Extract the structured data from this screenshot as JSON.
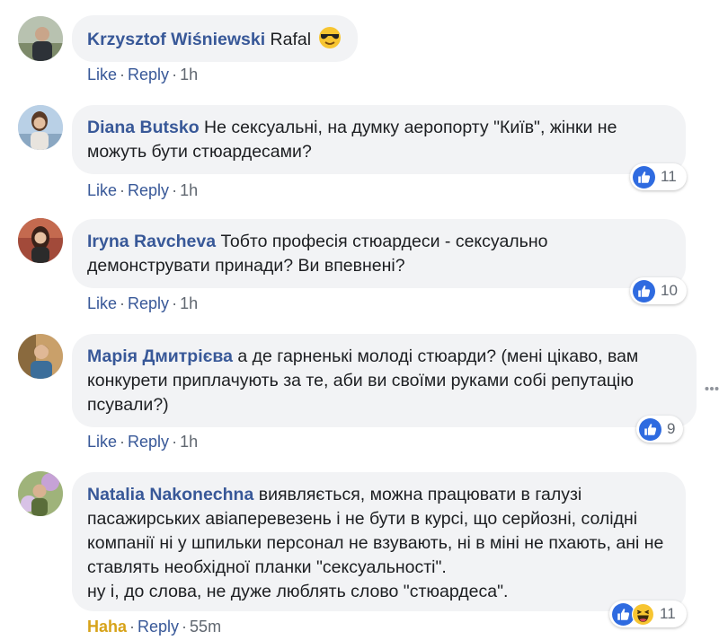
{
  "colors": {
    "author": "#385898",
    "bubble": "#f2f3f5",
    "meta": "#606770",
    "like_blue": "#2f6be0",
    "haha_yellow": "#d7a31a"
  },
  "comments": [
    {
      "author": "Krzysztof Wiśniewski",
      "text": "Rafal",
      "emoji": "sunglasses-emoji",
      "actions": {
        "like": "Like",
        "reply": "Reply",
        "time": "1h"
      },
      "reactions": null
    },
    {
      "author": "Diana Butsko",
      "text": "Не сексуальні, на думку аеропорту \"Київ\", жінки не можуть бути стюардесами?",
      "actions": {
        "like": "Like",
        "reply": "Reply",
        "time": "1h"
      },
      "reactions": {
        "icons": [
          "like-icon"
        ],
        "count": "11"
      }
    },
    {
      "author": "Iryna Ravcheva",
      "text": "Тобто професія стюардеси - сексуально демонструвати принади? Ви впевнені?",
      "actions": {
        "like": "Like",
        "reply": "Reply",
        "time": "1h"
      },
      "reactions": {
        "icons": [
          "like-icon"
        ],
        "count": "10"
      }
    },
    {
      "author": "Марія Дмитрієва",
      "text": "а де гарненькі молоді стюарди? (мені цікаво, вам конкурети приплачують за те, аби ви своїми руками собі репутацію псували?)",
      "actions": {
        "like": "Like",
        "reply": "Reply",
        "time": "1h"
      },
      "reactions": {
        "icons": [
          "like-icon"
        ],
        "count": "9"
      }
    },
    {
      "author": "Natalia Nakonechna",
      "text": "виявляється, можна працювати в галузі пасажирських авіаперевезень і не бути в курсі, що серйозні, солідні компанії ні у шпильки персонал не взувають, ні в міні не пхають, ані не ставлять необхідної планки \"сексуальності\".",
      "text2": "ну і, до слова, не дуже люблять слово \"стюардеса\".",
      "actions": {
        "like": "Haha",
        "reply": "Reply",
        "time": "55m"
      },
      "reactions": {
        "icons": [
          "like-icon",
          "haha-icon"
        ],
        "count": "11"
      }
    }
  ]
}
